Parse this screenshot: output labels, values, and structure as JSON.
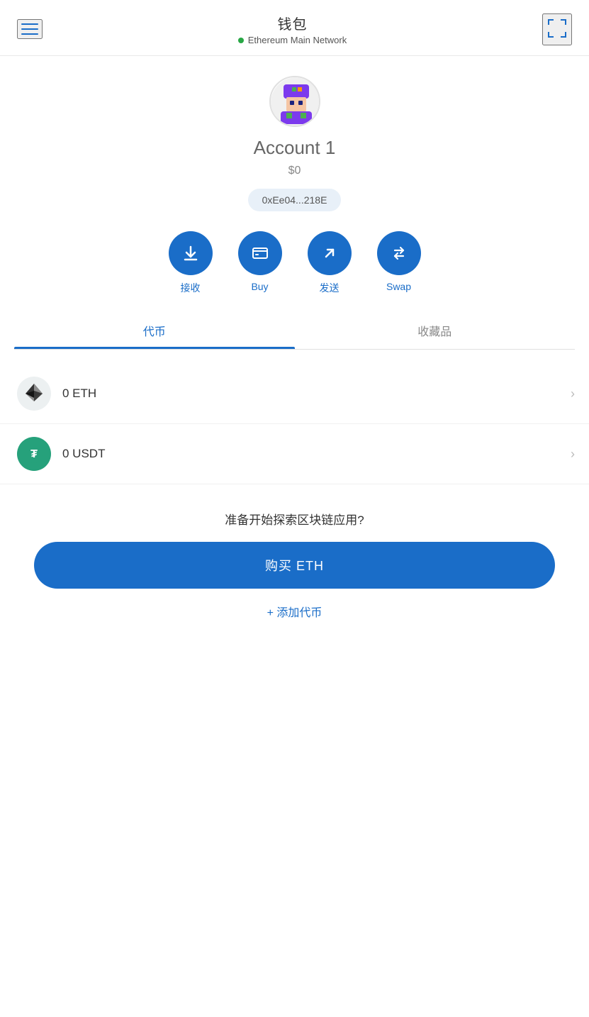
{
  "header": {
    "title": "钱包",
    "network": "Ethereum Main Network",
    "network_status": "online"
  },
  "account": {
    "name": "Account 1",
    "balance": "$0",
    "address": "0xEe04...218E"
  },
  "actions": [
    {
      "id": "receive",
      "label": "接收",
      "icon": "download"
    },
    {
      "id": "buy",
      "label": "Buy",
      "icon": "card"
    },
    {
      "id": "send",
      "label": "发送",
      "icon": "arrow-up-right"
    },
    {
      "id": "swap",
      "label": "Swap",
      "icon": "swap"
    }
  ],
  "tabs": [
    {
      "id": "tokens",
      "label": "代币",
      "active": true
    },
    {
      "id": "collectibles",
      "label": "收藏品",
      "active": false
    }
  ],
  "tokens": [
    {
      "id": "eth",
      "symbol": "ETH",
      "amount": "0 ETH",
      "icon_type": "eth"
    },
    {
      "id": "usdt",
      "symbol": "USDT",
      "amount": "0 USDT",
      "icon_type": "usdt"
    }
  ],
  "explore": {
    "title": "准备开始探索区块链应用?",
    "buy_btn": "购买 ETH",
    "add_token": "+ 添加代币"
  }
}
